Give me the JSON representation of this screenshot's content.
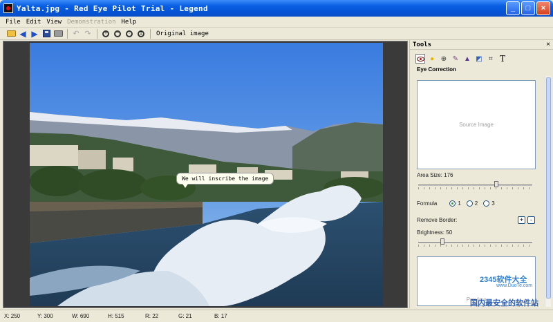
{
  "window": {
    "title": "Yalta.jpg - Red Eye Pilot Trial - Legend",
    "minimize": "_",
    "maximize": "□",
    "close": "×"
  },
  "menu": {
    "items": [
      {
        "label": "File",
        "enabled": true
      },
      {
        "label": "Edit",
        "enabled": true
      },
      {
        "label": "View",
        "enabled": true
      },
      {
        "label": "Demonstration",
        "enabled": false
      },
      {
        "label": "Help",
        "enabled": true
      }
    ]
  },
  "toolbar": {
    "icons": [
      "open-folder-icon",
      "back-arrow-icon",
      "forward-arrow-icon",
      "save-icon",
      "print-icon",
      "undo-icon",
      "redo-icon",
      "zoom-in-icon",
      "zoom-out-icon",
      "zoom-fit-icon",
      "zoom-actual-icon"
    ],
    "original_image_label": "Original image"
  },
  "canvas": {
    "callout_text": "We will inscribe the image",
    "watermark": "www.DuoTe.com"
  },
  "tools": {
    "title": "Tools",
    "close": "×",
    "tool_icons": [
      "red-eye-icon",
      "light-bulb-icon",
      "target-icon",
      "brush-icon",
      "effects-icon",
      "color-icon",
      "crop-icon",
      "text-icon"
    ],
    "text_tool_glyph": "T",
    "section": "Eye Correction",
    "source_placeholder": "Source Image",
    "area_size_label": "Area Size: 176",
    "area_size_fraction": 0.69,
    "formula_label": "Formula",
    "formula_options": [
      "1",
      "2",
      "3"
    ],
    "formula_selected": "1",
    "remove_border_label": "Remove Border:",
    "plus": "+",
    "minus": "-",
    "brightness_label": "Brightness: 50",
    "brightness_fraction": 0.2,
    "preview_placeholder": "Preview"
  },
  "status": {
    "x": "X: 250",
    "y": "Y: 300",
    "w": "W: 690",
    "h": "H: 515",
    "r": "R: 22",
    "g": "G: 21",
    "b": "B: 17"
  },
  "site_watermark": {
    "brand": "2345软件大全",
    "url": "www.DuoTe.com",
    "slogan": "国内最安全的软件站"
  },
  "colors": {
    "titlebar": "#0554d6",
    "panel": "#ece9d8",
    "workspace": "#3a3a3a"
  }
}
